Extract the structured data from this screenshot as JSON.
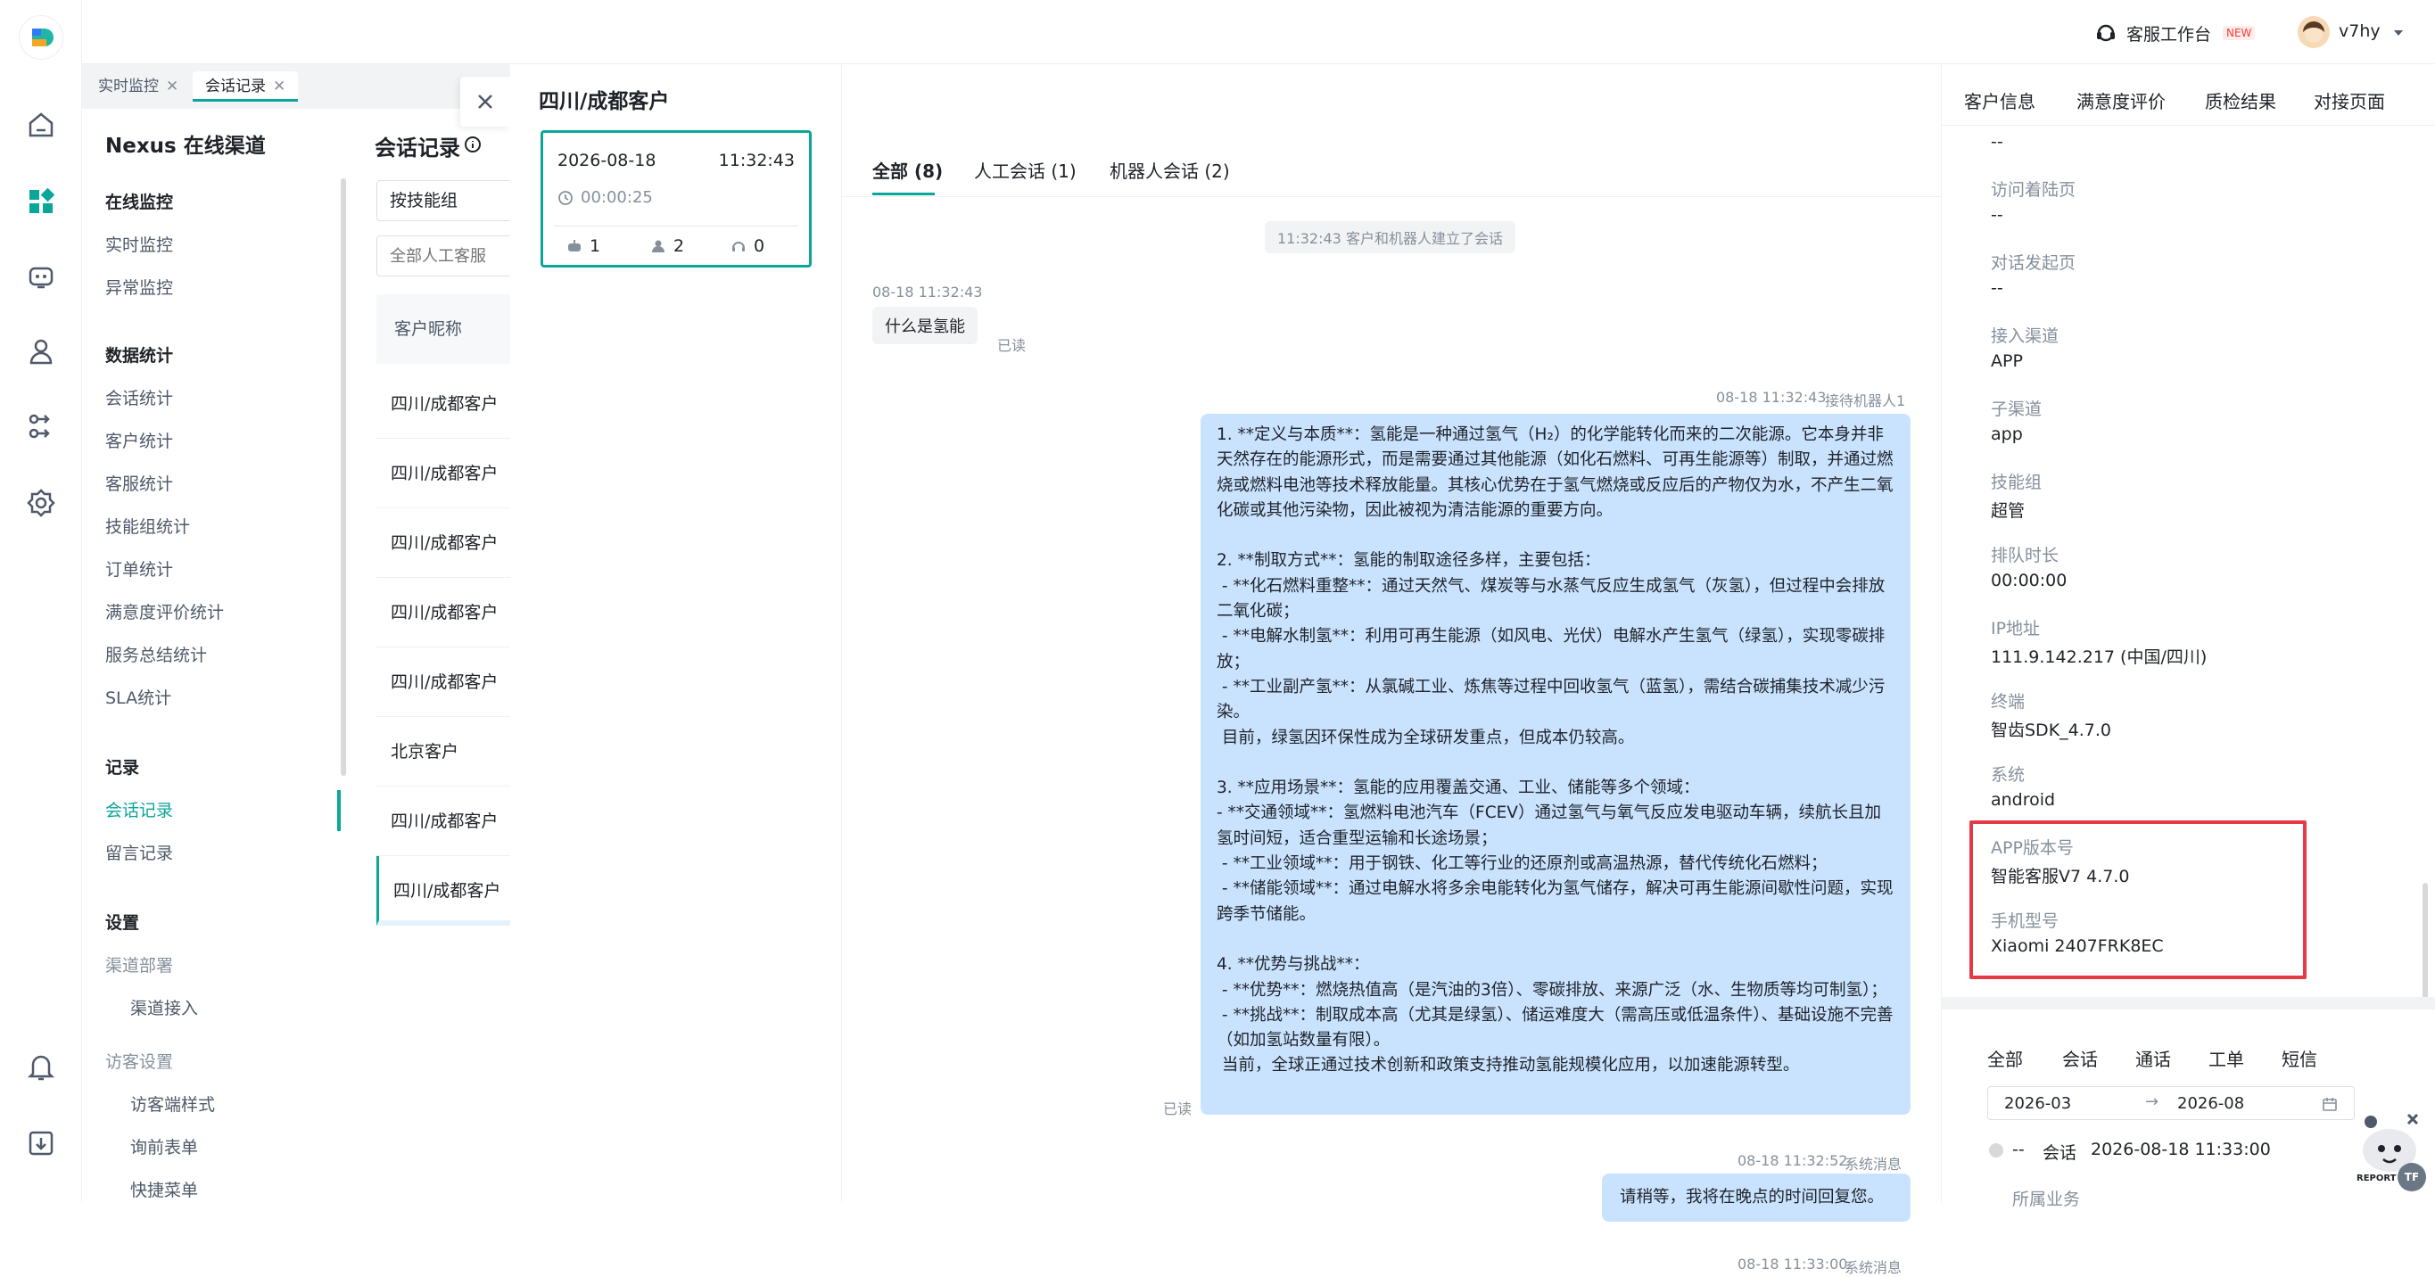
{
  "topbar": {
    "workbench_label": "客服工作台",
    "new_badge": "NEW",
    "username": "v7hy"
  },
  "tabs": [
    {
      "label": "实时监控"
    },
    {
      "label": "会话记录"
    }
  ],
  "nav": {
    "title": "Nexus 在线渠道",
    "groups": {
      "monitor": {
        "title": "在线监控",
        "items": [
          "实时监控",
          "异常监控"
        ]
      },
      "stats": {
        "title": "数据统计",
        "items": [
          "会话统计",
          "客户统计",
          "客服统计",
          "技能组统计",
          "订单统计",
          "满意度评价统计",
          "服务总结统计",
          "SLA统计"
        ]
      },
      "records": {
        "title": "记录",
        "items": [
          "会话记录",
          "留言记录"
        ]
      },
      "settings": {
        "title": "设置",
        "items": [
          "渠道部署",
          "渠道接入",
          "访客设置",
          "访客端样式",
          "询前表单",
          "快捷菜单"
        ]
      }
    }
  },
  "list": {
    "title": "会话记录",
    "skill_select": "按技能组",
    "agent_placeholder": "全部人工客服",
    "column_header": "客户昵称",
    "rows": [
      "四川/成都客户",
      "四川/成都客户",
      "四川/成都客户",
      "四川/成都客户",
      "四川/成都客户",
      "北京客户",
      "四川/成都客户",
      "四川/成都客户"
    ]
  },
  "session": {
    "title": "四川/成都客户",
    "card": {
      "date": "2026-08-18",
      "time": "11:32:43",
      "duration": "00:00:25",
      "robot_count": "1",
      "human_count": "2",
      "agent_count": "0"
    }
  },
  "chat": {
    "tabs": [
      "全部 (8)",
      "人工会话 (1)",
      "机器人会话 (2)"
    ],
    "system_notice": "11:32:43 客户和机器人建立了会话",
    "msg1": {
      "time": "08-18 11:32:43",
      "text": "什么是氢能",
      "status": "已读"
    },
    "msg2": {
      "time": "08-18 11:32:43",
      "sender": "接待机器人1",
      "status": "已读",
      "text": "1. **定义与本质**：氢能是一种通过氢气（H₂）的化学能转化而来的二次能源。它本身并非天然存在的能源形式，而是需要通过其他能源（如化石燃料、可再生能源等）制取，并通过燃烧或燃料电池等技术释放能量。其核心优势在于氢气燃烧或反应后的产物仅为水，不产生二氧化碳或其他污染物，因此被视为清洁能源的重要方向。\n\n2. **制取方式**：氢能的制取途径多样，主要包括：\n - **化石燃料重整**：通过天然气、煤炭等与水蒸气反应生成氢气（灰氢），但过程中会排放二氧化碳；\n - **电解水制氢**：利用可再生能源（如风电、光伏）电解水产生氢气（绿氢），实现零碳排放；\n - **工业副产氢**：从氯碱工业、炼焦等过程中回收氢气（蓝氢），需结合碳捕集技术减少污染。\n 目前，绿氢因环保性成为全球研发重点，但成本仍较高。\n\n3. **应用场景**：氢能的应用覆盖交通、工业、储能等多个领域：\n- **交通领域**：氢燃料电池汽车（FCEV）通过氢气与氧气反应发电驱动车辆，续航长且加氢时间短，适合重型运输和长途场景；\n - **工业领域**：用于钢铁、化工等行业的还原剂或高温热源，替代传统化石燃料；\n - **储能领域**：通过电解水将多余电能转化为氢气储存，解决可再生能源间歇性问题，实现跨季节储能。\n\n4. **优势与挑战**：\n - **优势**：燃烧热值高（是汽油的3倍）、零碳排放、来源广泛（水、生物质等均可制氢）；\n - **挑战**：制取成本高（尤其是绿氢）、储运难度大（需高压或低温条件）、基础设施不完善（如加氢站数量有限）。\n 当前，全球正通过技术创新和政策支持推动氢能规模化应用，以加速能源转型。"
    },
    "msg3": {
      "time": "08-18 11:32:52",
      "sender": "系统消息",
      "text": "请稍等，我将在晚点的时间回复您。"
    },
    "msg4": {
      "time": "08-18 11:33:00",
      "sender": "系统消息"
    }
  },
  "right": {
    "tabs": [
      "客户信息",
      "满意度评价",
      "质检结果",
      "对接页面"
    ],
    "top_value": "--",
    "fields": [
      {
        "label": "访问着陆页",
        "value": "--"
      },
      {
        "label": "对话发起页",
        "value": "--"
      },
      {
        "label": "接入渠道",
        "value": "APP"
      },
      {
        "label": "子渠道",
        "value": "app"
      },
      {
        "label": "技能组",
        "value": "超管"
      },
      {
        "label": "排队时长",
        "value": "00:00:00"
      },
      {
        "label": "IP地址",
        "value": "111.9.142.217 (中国/四川)"
      },
      {
        "label": "终端",
        "value": "智齿SDK_4.7.0"
      },
      {
        "label": "系统",
        "value": "android"
      },
      {
        "label": "APP版本号",
        "value": "智能客服V7 4.7.0"
      },
      {
        "label": "手机型号",
        "value": "Xiaomi 2407FRK8EC"
      }
    ],
    "history_tabs": [
      "全部",
      "会话",
      "通话",
      "工单",
      "短信"
    ],
    "date_start": "2026-03",
    "date_end": "2026-08",
    "history_item": {
      "dash": "--",
      "type": "会话",
      "time": "2026-08-18 11:33:00"
    },
    "history_sub": "所属业务",
    "report_label": "REPORT",
    "report_tf": "TF"
  }
}
